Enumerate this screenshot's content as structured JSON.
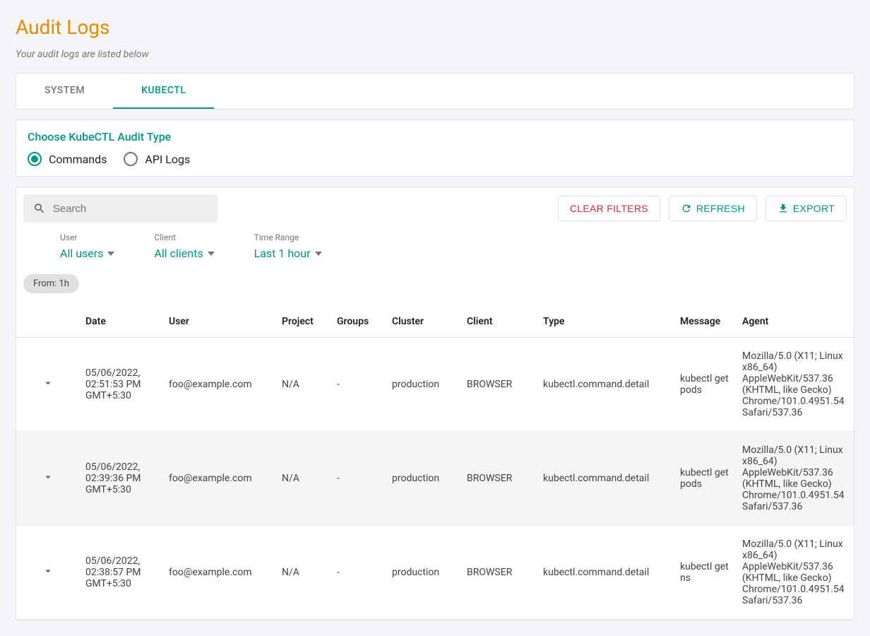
{
  "header": {
    "title": "Audit Logs",
    "subtitle": "Your audit logs are listed below"
  },
  "tabs": {
    "system": "SYSTEM",
    "kubectl": "KUBECTL"
  },
  "audit_type": {
    "title": "Choose KubeCTL Audit Type",
    "commands": "Commands",
    "api_logs": "API Logs"
  },
  "search": {
    "placeholder": "Search"
  },
  "buttons": {
    "clear_filters": "CLEAR FILTERS",
    "refresh": "REFRESH",
    "export": "EXPORT"
  },
  "filters": {
    "user": {
      "label": "User",
      "value": "All users"
    },
    "client": {
      "label": "Client",
      "value": "All clients"
    },
    "time_range": {
      "label": "Time Range",
      "value": "Last 1 hour"
    }
  },
  "chip": "From: 1h",
  "columns": {
    "date": "Date",
    "user": "User",
    "project": "Project",
    "groups": "Groups",
    "cluster": "Cluster",
    "client": "Client",
    "type": "Type",
    "message": "Message",
    "agent": "Agent"
  },
  "rows": [
    {
      "date": "05/06/2022, 02:51:53 PM GMT+5:30",
      "user": "foo@example.com",
      "project": "N/A",
      "groups": "-",
      "cluster": "production",
      "client": "BROWSER",
      "type": "kubectl.command.detail",
      "message": "kubectl get pods",
      "agent": "Mozilla/5.0 (X11; Linux x86_64) AppleWebKit/537.36 (KHTML, like Gecko) Chrome/101.0.4951.54 Safari/537.36"
    },
    {
      "date": "05/06/2022, 02:39:36 PM GMT+5:30",
      "user": "foo@example.com",
      "project": "N/A",
      "groups": "-",
      "cluster": "production",
      "client": "BROWSER",
      "type": "kubectl.command.detail",
      "message": "kubectl get pods",
      "agent": "Mozilla/5.0 (X11; Linux x86_64) AppleWebKit/537.36 (KHTML, like Gecko) Chrome/101.0.4951.54 Safari/537.36"
    },
    {
      "date": "05/06/2022, 02:38:57 PM GMT+5:30",
      "user": "foo@example.com",
      "project": "N/A",
      "groups": "-",
      "cluster": "production",
      "client": "BROWSER",
      "type": "kubectl.command.detail",
      "message": "kubectl get ns",
      "agent": "Mozilla/5.0 (X11; Linux x86_64) AppleWebKit/537.36 (KHTML, like Gecko) Chrome/101.0.4951.54 Safari/537.36"
    }
  ]
}
